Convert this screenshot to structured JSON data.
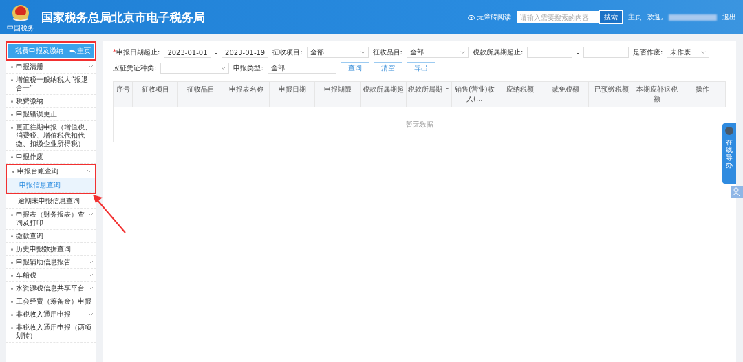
{
  "header": {
    "title": "国家税务总局北京市电子税务局",
    "logo_caption": "中国税务",
    "accessibility": "无障碍阅读",
    "search": {
      "placeholder": "请输入需要搜索的内容",
      "button": "搜索"
    },
    "home": "主页",
    "welcome": "欢迎,",
    "logout": "退出"
  },
  "sidebar": {
    "section": "税费申报及缴纳",
    "home_button": "主页",
    "items": [
      {
        "label": "申报清册",
        "expandable": true,
        "highlighted": false
      },
      {
        "label": "增值税一般纳税人“报退合一”",
        "expandable": false,
        "highlighted": false
      },
      {
        "label": "税费缴纳",
        "expandable": false,
        "highlighted": false
      },
      {
        "label": "申报错误更正",
        "expandable": false,
        "highlighted": false
      },
      {
        "label": "更正往期申报（增值税、消费税、增值税代扣代缴、扣缴企业所得税）",
        "expandable": false,
        "highlighted": false
      },
      {
        "label": "申报作废",
        "expandable": false,
        "highlighted": false
      },
      {
        "label": "申报台账查询",
        "expandable": true,
        "highlighted": true,
        "children": [
          {
            "label": "申报信息查询",
            "selected": true
          }
        ]
      },
      {
        "label": "逾期未申报信息查询",
        "kind": "sub"
      },
      {
        "label": "申报表（财务报表）查询及打印",
        "expandable": true,
        "highlighted": false
      },
      {
        "label": "缴款查询",
        "expandable": false,
        "highlighted": false
      },
      {
        "label": "历史申报数据查询",
        "expandable": false,
        "highlighted": false
      },
      {
        "label": "申报辅助信息报告",
        "expandable": true,
        "highlighted": false
      },
      {
        "label": "车船税",
        "expandable": true,
        "highlighted": false
      },
      {
        "label": "水资源税信息共享平台",
        "expandable": true,
        "highlighted": false
      },
      {
        "label": "工会经费（筹备金）申报",
        "expandable": false,
        "highlighted": false
      },
      {
        "label": "非税收入通用申报",
        "expandable": true,
        "highlighted": false
      },
      {
        "label": "非税收入通用申报（两项划转）",
        "expandable": false,
        "highlighted": false
      }
    ]
  },
  "filters": [
    {
      "kind": "daterange",
      "label": "申报日期起止:",
      "required_mark": "*",
      "separator": "-",
      "from": "2023-01-01",
      "to": "2023-01-19"
    },
    {
      "kind": "select",
      "label": "征收项目:",
      "value": "全部"
    },
    {
      "kind": "select",
      "label": "征收品目:",
      "value": "全部"
    },
    {
      "kind": "daterange",
      "label": "税款所属期起止:",
      "separator": "-"
    },
    {
      "kind": "select",
      "label": "是否作废:",
      "value": "未作废"
    },
    {
      "kind": "select",
      "label": "应征凭证种类:"
    },
    {
      "kind": "text",
      "label": "申报类型:",
      "value": "全部"
    }
  ],
  "actions": [
    "查询",
    "清空",
    "导出"
  ],
  "table": {
    "columns": [
      "序号",
      "征收项目",
      "征收品目",
      "申报表名称",
      "申报日期",
      "申报期限",
      "税款所属期起",
      "税款所属期止",
      "销售(营业)收入(...",
      "应纳税额",
      "减免税额",
      "已预缴税额",
      "本期应补退税额",
      "操作"
    ],
    "empty": "暂无数据"
  },
  "side_tab": "在线导办"
}
